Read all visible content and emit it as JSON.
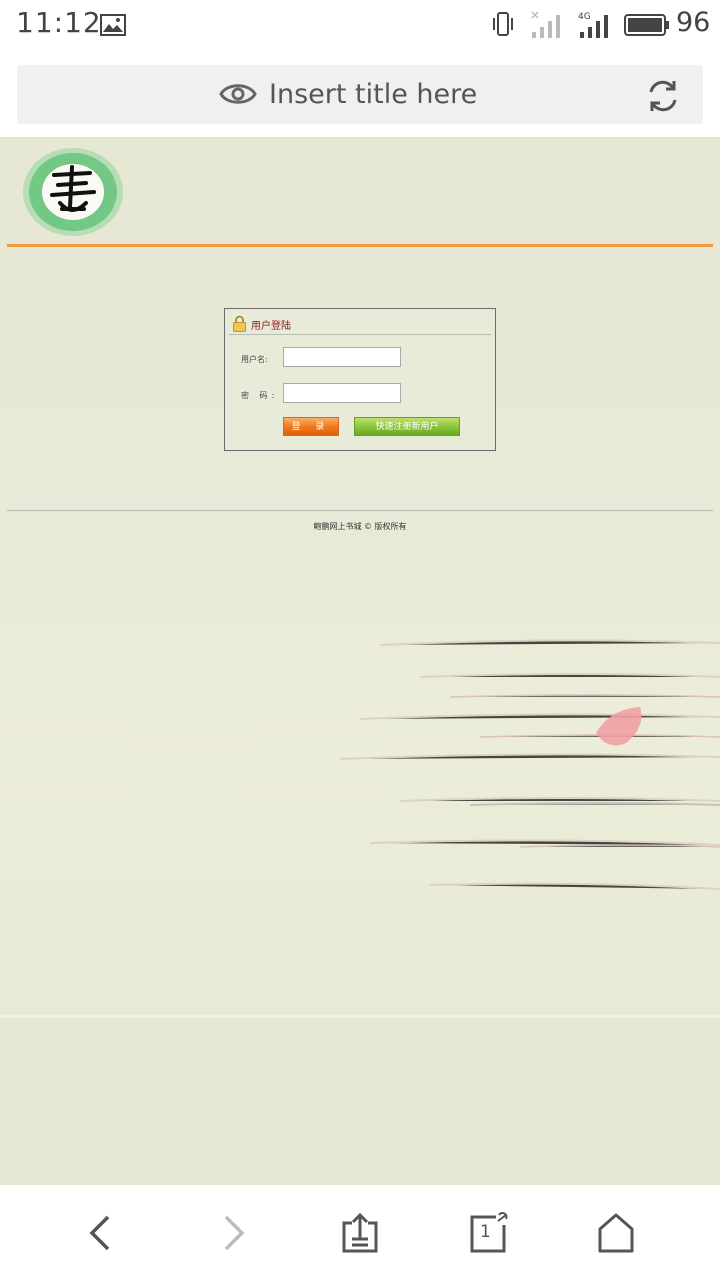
{
  "status_bar": {
    "time": "11:12",
    "network": "4G",
    "battery": "96"
  },
  "browser": {
    "page_title": "Insert title here",
    "tab_count": "1"
  },
  "page": {
    "colors": {
      "accent_line": "#f29a3d",
      "login_button": "#f07a1e",
      "register_button": "#8dc63f",
      "background": "#e8ead8"
    },
    "login": {
      "title": "用户登陆",
      "username_label": "用户名:",
      "password_label": "密 码:",
      "username_value": "",
      "password_value": "",
      "login_button": "登 录",
      "register_button": "快速注册新用户"
    },
    "footer": {
      "copyright": "鲍鹏网上书城 © 版权所有"
    }
  }
}
